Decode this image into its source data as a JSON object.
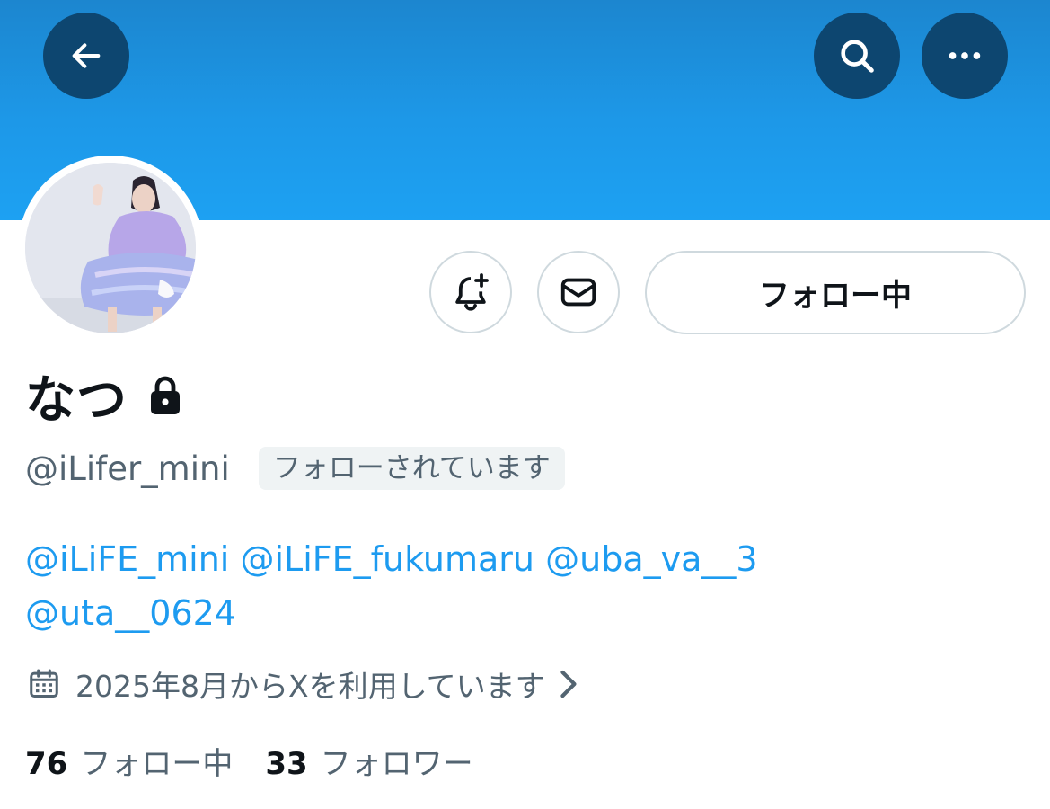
{
  "header": {
    "back_icon": "arrow-left-icon",
    "search_icon": "search-icon",
    "more_icon": "more-horizontal-icon",
    "banner_color": "#1d9bf0",
    "button_bg": "#0d4670"
  },
  "profile": {
    "display_name": "なつ",
    "protected_icon": "lock-icon",
    "handle": "@iLifer_mini",
    "follows_you_badge": "フォローされています",
    "bio_mentions": [
      "@iLiFE_mini",
      "@iLiFE_fukumaru",
      "@uba_va__3",
      "@uta__0624"
    ],
    "joined_text": "2025年8月からXを利用しています"
  },
  "actions": {
    "notify_icon": "bell-plus-icon",
    "message_icon": "mail-icon",
    "follow_label": "フォロー中"
  },
  "stats": {
    "following_count": "76",
    "following_label": "フォロー中",
    "followers_count": "33",
    "followers_label": "フォロワー"
  },
  "colors": {
    "link": "#1d9bf0",
    "secondary_text": "#536471",
    "primary_text": "#0f1419"
  }
}
